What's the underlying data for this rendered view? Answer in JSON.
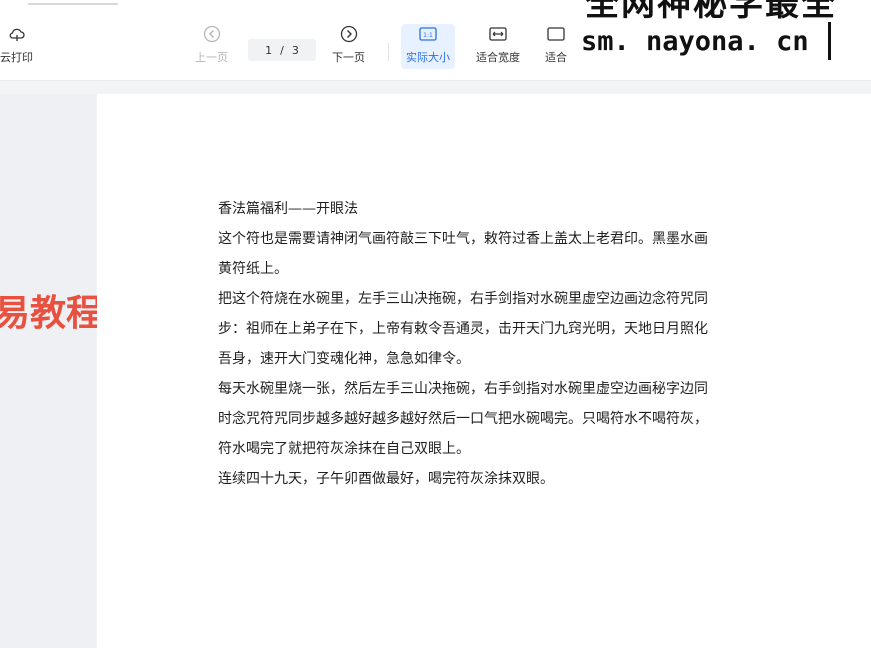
{
  "toolbar": {
    "cloud_print_label": "云打印",
    "prev_label": "上一页",
    "next_label": "下一页",
    "page_current": "1",
    "page_sep": "/",
    "page_total": "3",
    "actual_size_label": "实际大小",
    "fit_width_label": "适合宽度",
    "fit_page_label": "适合"
  },
  "watermark": {
    "banner_text": "全网神秘学最全",
    "url": "sm. nayona. cn",
    "left_text": "易教程"
  },
  "document": {
    "title": "香法篇福利——开眼法",
    "lines": [
      "这个符也是需要请神闭气画符敲三下吐气，敕符过香上盖太上老君印。黑墨水画",
      "黄符纸上。",
      "把这个符烧在水碗里，左手三山决拖碗，右手剑指对水碗里虚空边画边念符咒同",
      "步：祖师在上弟子在下，上帝有敕令吾通灵，击开天门九窍光明，天地日月照化",
      "吾身，速开大门变魂化神，急急如律令。",
      "每天水碗里烧一张，然后左手三山决拖碗，右手剑指对水碗里虚空边画秘字边同",
      "时念咒符咒同步越多越好越多越好然后一口气把水碗喝完。只喝符水不喝符灰，",
      "符水喝完了就把符灰涂抹在自己双眼上。",
      "连续四十九天，子午卯酉做最好，喝完符灰涂抹双眼。"
    ]
  },
  "colors": {
    "accent": "#2b6fe6",
    "active_bg": "#e8f1ff",
    "watermark_red": "#e8513f"
  }
}
